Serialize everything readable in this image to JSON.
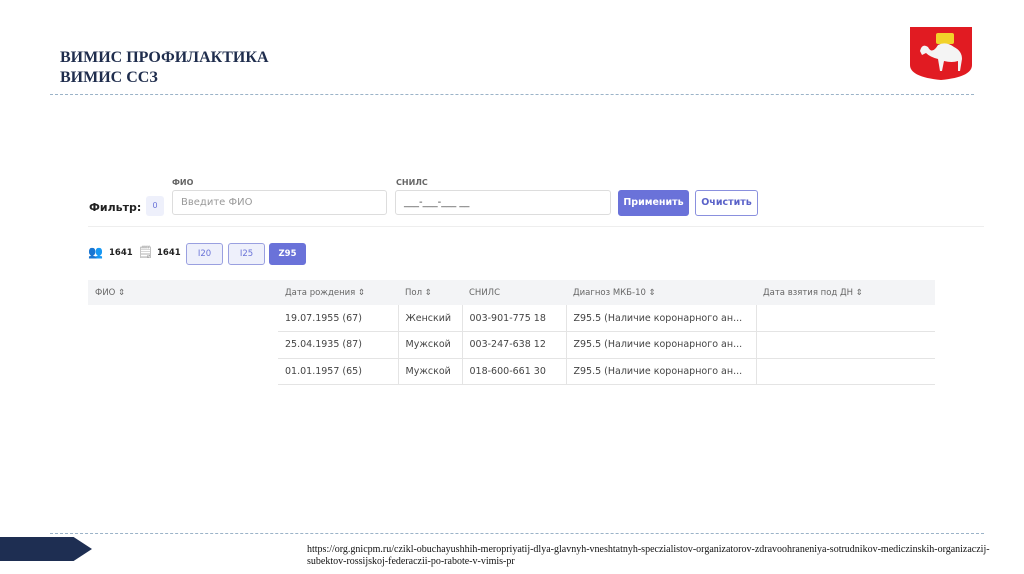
{
  "header": {
    "line1": "ВИМИС ПРОФИЛАКТИКА",
    "line2": "ВИМИС ССЗ"
  },
  "filter": {
    "label": "Фильтр:",
    "count": "0",
    "fio_label": "ФИО",
    "fio_placeholder": "Введите ФИО",
    "snils_label": "СНИЛС",
    "snils_value": "___-___-___ __",
    "apply": "Применить",
    "clear": "Очистить"
  },
  "stats": {
    "patients": "1641",
    "records": "1641",
    "chips": [
      "I20",
      "I25",
      "Z95"
    ]
  },
  "table": {
    "headers": [
      "ФИО ⇕",
      "Дата рождения ⇕",
      "Пол ⇕",
      "СНИЛС",
      "Диагноз МКБ-10 ⇕",
      "Дата взятия под ДН ⇕"
    ],
    "rows": [
      [
        "",
        "19.07.1955 (67)",
        "Женский",
        "003-901-775 18",
        "Z95.5 (Наличие коронарного ан...",
        ""
      ],
      [
        "",
        "25.04.1935 (87)",
        "Мужской",
        "003-247-638 12",
        "Z95.5 (Наличие коронарного ан...",
        ""
      ],
      [
        "",
        "01.01.1957 (65)",
        "Мужской",
        "018-600-661 30",
        "Z95.5 (Наличие коронарного ан...",
        ""
      ]
    ]
  },
  "footer": {
    "url": "https://org.gnicpm.ru/czikl-obuchayushhih-meropriyatij-dlya-glavnyh-vneshtatnyh-speczialistov-organizatorov-zdravoohraneniya-sotrudnikov-mediczinskih-organizaczij-subektov-rossijskoj-federaczii-po-rabote-v-vimis-pr"
  }
}
